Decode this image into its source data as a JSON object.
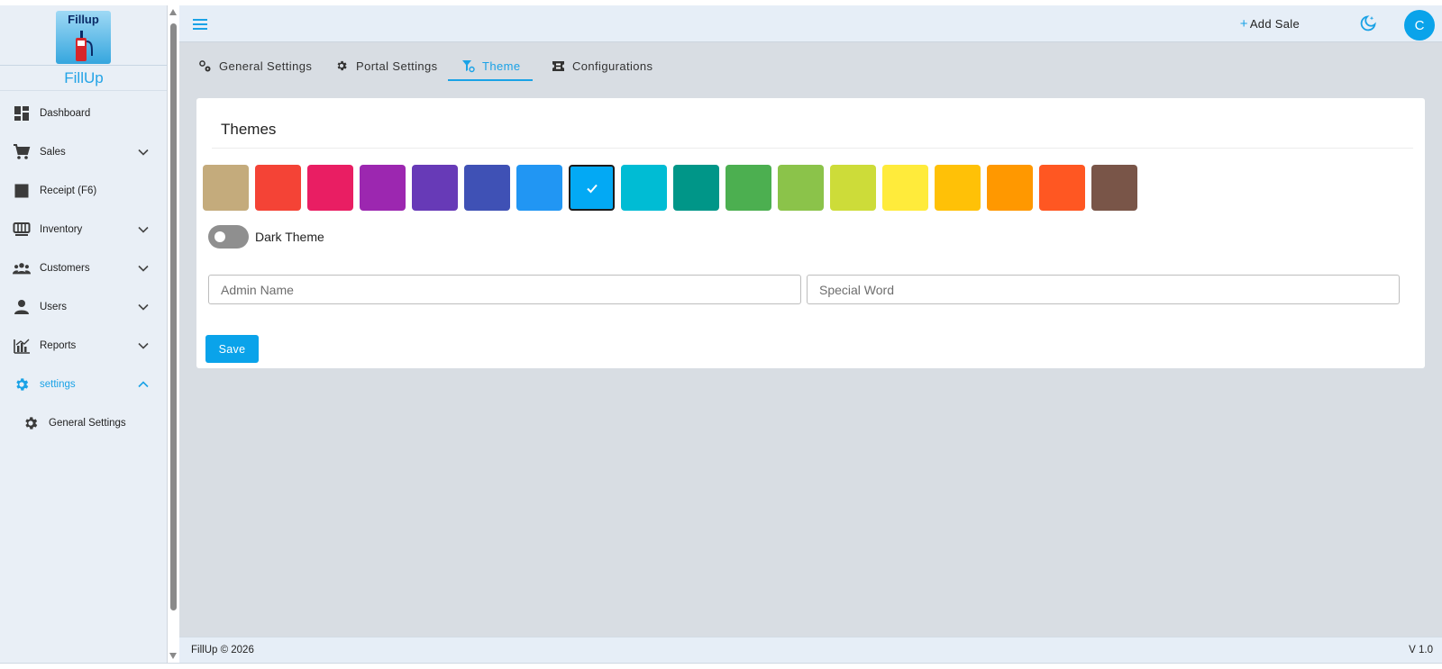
{
  "brand": {
    "logo_text": "Fillup",
    "name": "FillUp"
  },
  "sidebar": {
    "items": [
      {
        "label": "Dashboard",
        "icon": "dashboard-icon",
        "expandable": false
      },
      {
        "label": "Sales",
        "icon": "cart-icon",
        "expandable": true
      },
      {
        "label": "Receipt (F6)",
        "icon": "receipt-icon",
        "expandable": false
      },
      {
        "label": "Inventory",
        "icon": "inventory-icon",
        "expandable": true
      },
      {
        "label": "Customers",
        "icon": "customers-icon",
        "expandable": true
      },
      {
        "label": "Users",
        "icon": "user-icon",
        "expandable": true
      },
      {
        "label": "Reports",
        "icon": "reports-icon",
        "expandable": true
      },
      {
        "label": "settings",
        "icon": "gear-icon",
        "expandable": true,
        "active": true
      }
    ],
    "sub_items": [
      {
        "label": "General Settings",
        "icon": "gear-icon"
      }
    ]
  },
  "topbar": {
    "add_sale_label": "Add Sale",
    "avatar_initial": "C"
  },
  "tabs": [
    {
      "label": "General Settings",
      "icon": "gears-icon"
    },
    {
      "label": "Portal Settings",
      "icon": "gear-icon"
    },
    {
      "label": "Theme",
      "icon": "theme-icon",
      "active": true
    },
    {
      "label": "Configurations",
      "icon": "ticket-icon"
    }
  ],
  "theme": {
    "title": "Themes",
    "swatches": [
      "#c4ab7c",
      "#f44336",
      "#e91e63",
      "#9c27b0",
      "#673ab7",
      "#3f51b5",
      "#2196f3",
      "#03a9f4",
      "#00bcd4",
      "#009688",
      "#4caf50",
      "#8bc34a",
      "#cddc39",
      "#ffeb3b",
      "#ffc107",
      "#ff9800",
      "#ff5722",
      "#795548"
    ],
    "selected_index": 7,
    "dark_theme_label": "Dark Theme",
    "dark_theme_on": false,
    "admin_name_placeholder": "Admin Name",
    "special_word_placeholder": "Special Word",
    "save_label": "Save"
  },
  "footer": {
    "copyright": "FillUp © 2026",
    "version": "V 1.0"
  },
  "colors": {
    "accent": "#0aa3ea",
    "sidebar_bg": "#e9eff6",
    "main_bg": "#d8dde3"
  }
}
